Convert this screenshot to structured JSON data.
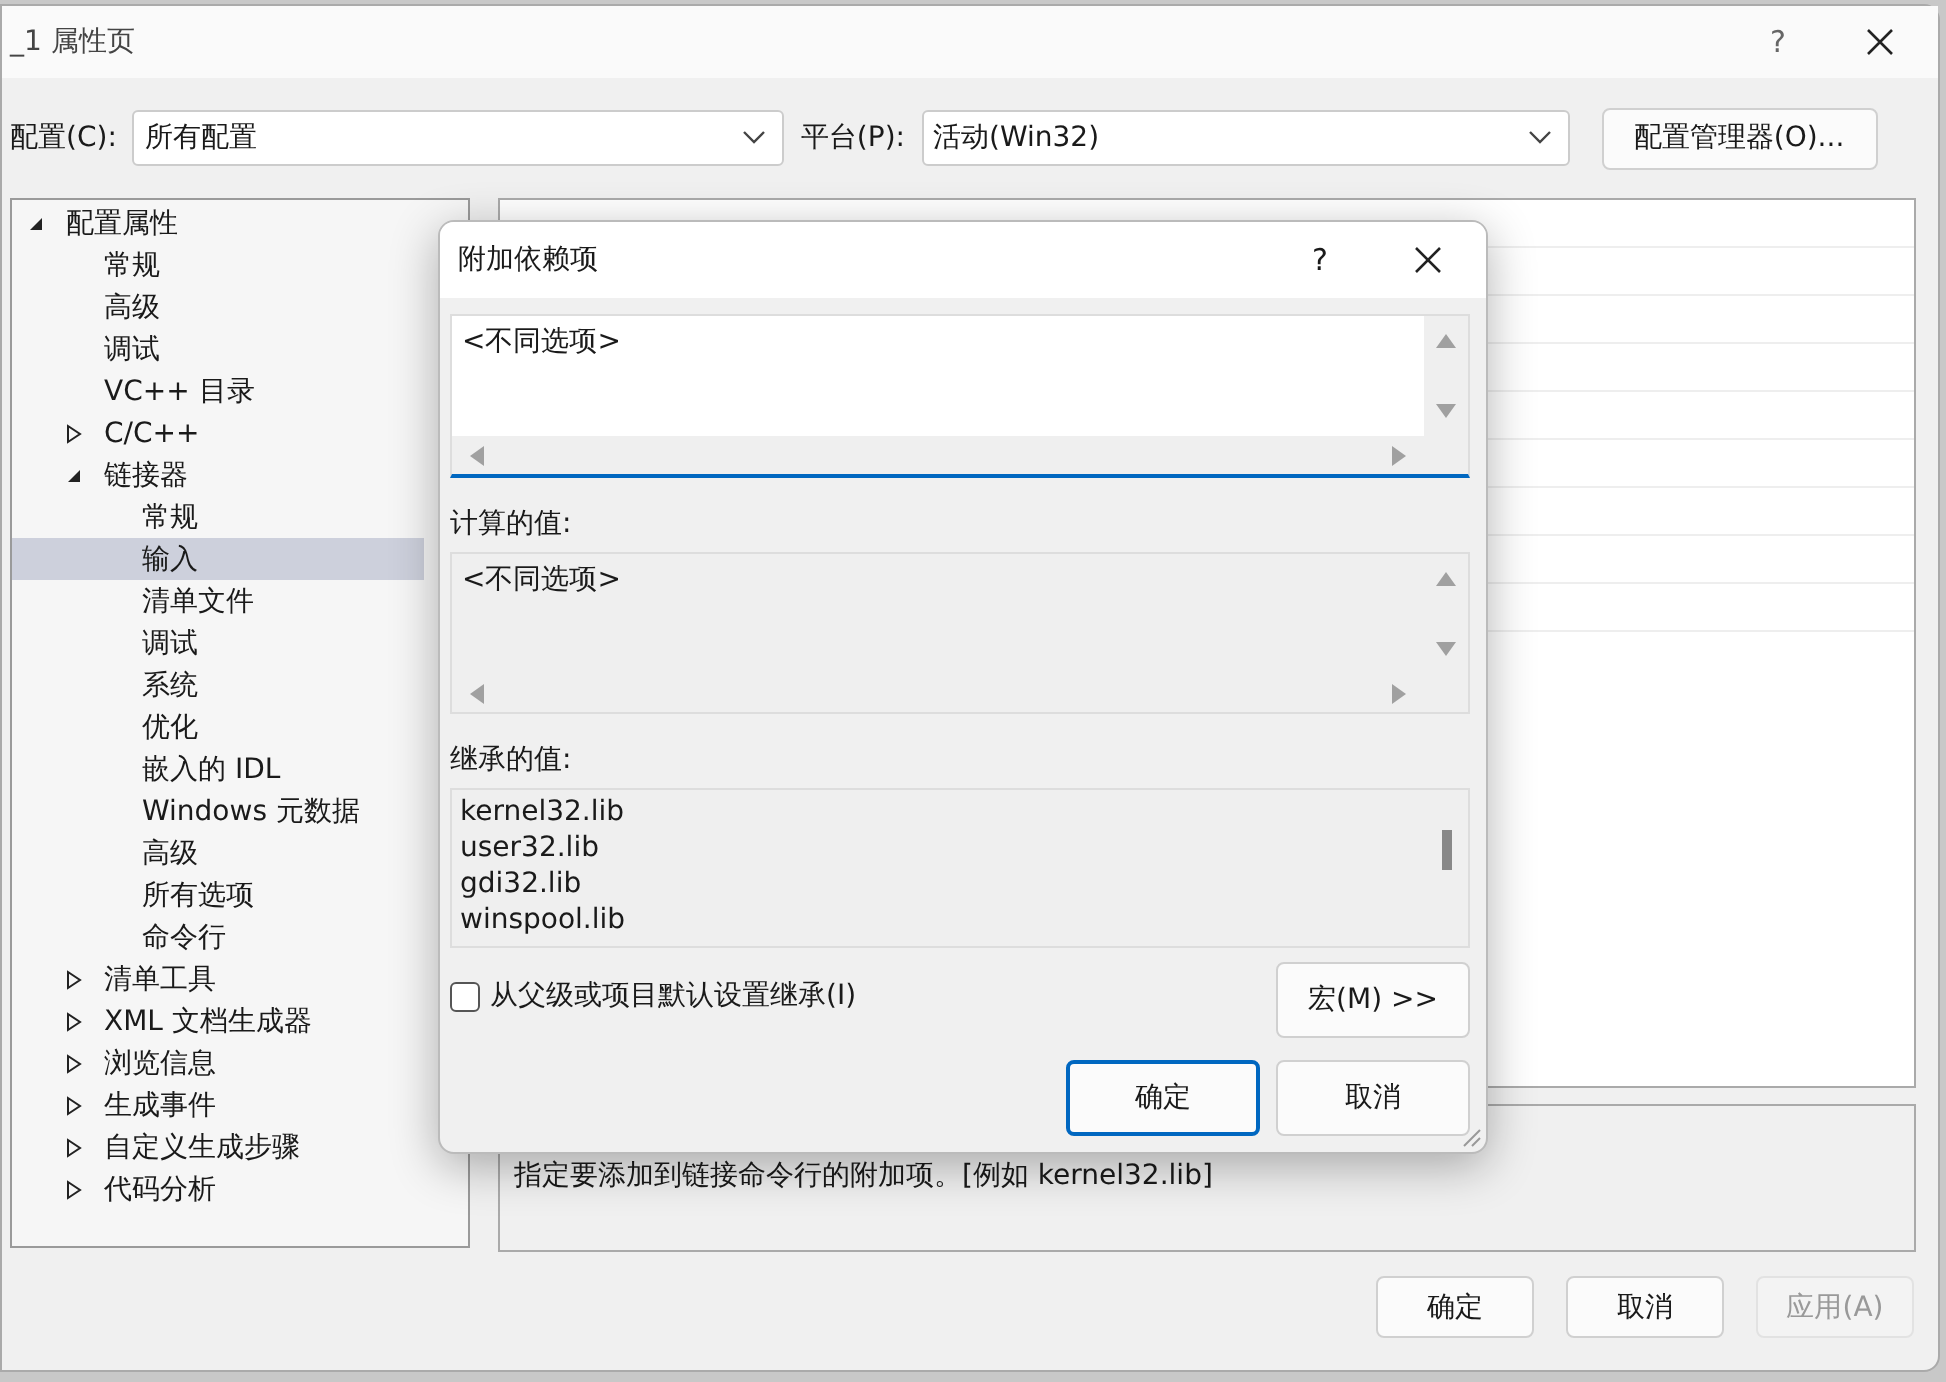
{
  "window": {
    "title": "_1 属性页",
    "help": "?"
  },
  "toolbar": {
    "config_label": "配置(C):",
    "config_value": "所有配置",
    "platform_label": "平台(P):",
    "platform_value": "活动(Win32)",
    "manager_button": "配置管理器(O)..."
  },
  "tree": [
    {
      "label": "配置属性",
      "expanded": true,
      "selected": false,
      "children": [
        {
          "label": "常规",
          "selected": false
        },
        {
          "label": "高级",
          "selected": false
        },
        {
          "label": "调试",
          "selected": false
        },
        {
          "label": "VC++ 目录",
          "selected": false
        },
        {
          "label": "C/C++",
          "expanded": false,
          "selected": false
        },
        {
          "label": "链接器",
          "expanded": true,
          "selected": false,
          "children": [
            {
              "label": "常规",
              "selected": false
            },
            {
              "label": "输入",
              "selected": true
            },
            {
              "label": "清单文件",
              "selected": false
            },
            {
              "label": "调试",
              "selected": false
            },
            {
              "label": "系统",
              "selected": false
            },
            {
              "label": "优化",
              "selected": false
            },
            {
              "label": "嵌入的 IDL",
              "selected": false
            },
            {
              "label": "Windows 元数据",
              "selected": false
            },
            {
              "label": "高级",
              "selected": false
            },
            {
              "label": "所有选项",
              "selected": false
            },
            {
              "label": "命令行",
              "selected": false
            }
          ]
        },
        {
          "label": "清单工具",
          "expanded": false,
          "selected": false
        },
        {
          "label": "XML 文档生成器",
          "expanded": false,
          "selected": false
        },
        {
          "label": "浏览信息",
          "expanded": false,
          "selected": false
        },
        {
          "label": "生成事件",
          "expanded": false,
          "selected": false
        },
        {
          "label": "自定义生成步骤",
          "expanded": false,
          "selected": false
        },
        {
          "label": "代码分析",
          "expanded": false,
          "selected": false
        }
      ]
    }
  ],
  "description": "指定要添加到链接命令行的附加项。[例如 kernel32.lib]",
  "buttons": [
    {
      "label": "确定",
      "disabled": false
    },
    {
      "label": "取消",
      "disabled": false
    },
    {
      "label": "应用(A)",
      "disabled": true
    }
  ],
  "dialog": {
    "title": "附加依赖项",
    "help": "?",
    "value": "<不同选项>",
    "computed_label": "计算的值:",
    "computed_value": "<不同选项>",
    "inherited_label": "继承的值:",
    "inherited_values": [
      "kernel32.lib",
      "user32.lib",
      "gdi32.lib",
      "winspool.lib"
    ],
    "inherit_checkbox": {
      "label": "从父级或项目默认设置继承(I)",
      "checked": false
    },
    "macro_button": "宏(M) >>",
    "buttons": [
      {
        "label": "确定",
        "focused": true
      },
      {
        "label": "取消",
        "focused": false
      }
    ]
  }
}
